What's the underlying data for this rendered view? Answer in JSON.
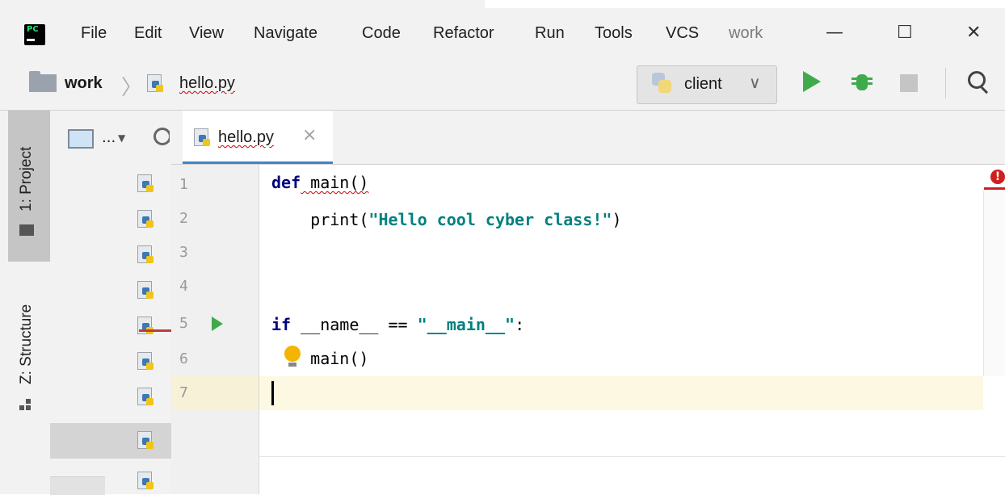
{
  "menu": {
    "items": [
      "File",
      "Edit",
      "View",
      "Navigate",
      "Code",
      "Refactor",
      "Run",
      "Tools",
      "VCS"
    ],
    "project_name": "work",
    "window_controls": [
      "—",
      "☐",
      "✕"
    ]
  },
  "navbar": {
    "breadcrumb_project": "work",
    "breadcrumb_file": "hello.py",
    "run_config": "client",
    "run_config_chevron": "∨"
  },
  "tool_windows": {
    "project": "1: Project",
    "structure": "Z: Structure"
  },
  "project_panel": {
    "view_selector": "..."
  },
  "editor": {
    "tab_label": "hello.py",
    "tab_close": "×",
    "line_numbers": [
      "1",
      "2",
      "3",
      "4",
      "5",
      "6",
      "7"
    ],
    "lines": [
      {
        "kw": "def",
        "rest": " main()"
      },
      {
        "indent": "    ",
        "func": "print(",
        "str": "\"Hello cool cyber class!\"",
        "end": ")"
      },
      {},
      {},
      {
        "kw": "if",
        "rest": " __name__ == ",
        "str": "\"__main__\"",
        "end": ":"
      },
      {
        "indent": "    ",
        "rest": "main()"
      },
      {}
    ],
    "error_marker": "!"
  },
  "colors": {
    "run_green": "#3faa4b",
    "keyword": "#000080",
    "string": "#008080",
    "error_red": "#d01f1f",
    "current_line": "#fdf8e2"
  },
  "icons": [
    "pycharm-logo-icon",
    "folder-icon",
    "python-file-icon",
    "python-icon",
    "run-icon",
    "debug-icon",
    "stop-icon",
    "search-icon",
    "gear-icon",
    "lightbulb-icon",
    "error-icon"
  ]
}
